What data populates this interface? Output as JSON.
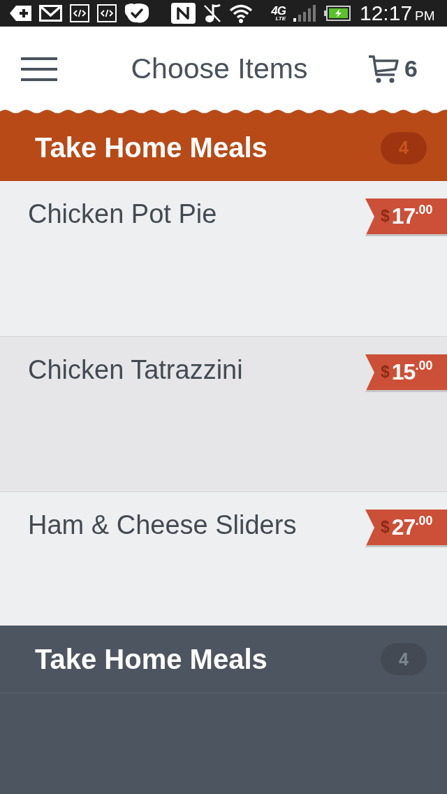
{
  "status_bar": {
    "network": "4G",
    "network_sub": "LTE",
    "time": "12:17",
    "meridiem": "PM"
  },
  "app_bar": {
    "title": "Choose Items",
    "cart_count": "6"
  },
  "categories": [
    {
      "name": "Take Home Meals",
      "count": "4",
      "expanded": true,
      "items": [
        {
          "name": "Chicken Pot Pie",
          "selected": false,
          "price": {
            "currency": "$",
            "whole": "17",
            "cents": ".00"
          }
        },
        {
          "name": "Chicken Tatrazzini",
          "selected": true,
          "price": {
            "currency": "$",
            "whole": "15",
            "cents": ".00"
          }
        },
        {
          "name": "Ham & Cheese Sliders",
          "selected": false,
          "price": {
            "currency": "$",
            "whole": "27",
            "cents": ".00"
          }
        }
      ]
    },
    {
      "name": "Take Home Meals",
      "count": "4",
      "expanded": false
    }
  ]
}
